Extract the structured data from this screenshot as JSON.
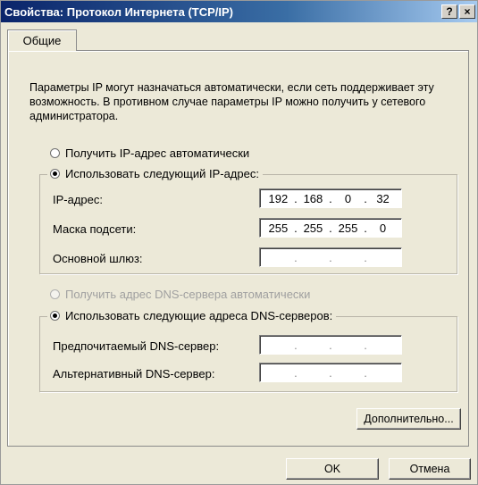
{
  "window": {
    "title": "Свойства: Протокол Интернета (TCP/IP)",
    "help_label": "?",
    "close_label": "×"
  },
  "tabs": [
    {
      "label": "Общие",
      "selected": true
    }
  ],
  "description": "Параметры IP могут назначаться автоматически, если сеть поддерживает эту возможность. В противном случае параметры IP можно получить у сетевого администратора.",
  "ip_section": {
    "auto_option": {
      "label": "Получить IP-адрес автоматически",
      "checked": false
    },
    "manual_option": {
      "label": "Использовать следующий IP-адрес:",
      "checked": true
    },
    "fields": [
      {
        "label": "IP-адрес:",
        "octets": [
          "192",
          "168",
          "0",
          "32"
        ]
      },
      {
        "label": "Маска подсети:",
        "octets": [
          "255",
          "255",
          "255",
          "0"
        ]
      },
      {
        "label": "Основной шлюз:",
        "octets": [
          "",
          "",
          "",
          ""
        ]
      }
    ]
  },
  "dns_section": {
    "auto_option": {
      "label": "Получить адрес DNS-сервера автоматически",
      "checked": false,
      "disabled": true
    },
    "manual_option": {
      "label": "Использовать следующие адреса DNS-серверов:",
      "checked": true
    },
    "fields": [
      {
        "label": "Предпочитаемый DNS-сервер:",
        "octets": [
          "",
          "",
          "",
          ""
        ]
      },
      {
        "label": "Альтернативный DNS-сервер:",
        "octets": [
          "",
          "",
          "",
          ""
        ]
      }
    ]
  },
  "buttons": {
    "advanced": "Дополнительно...",
    "ok": "OK",
    "cancel": "Отмена"
  }
}
